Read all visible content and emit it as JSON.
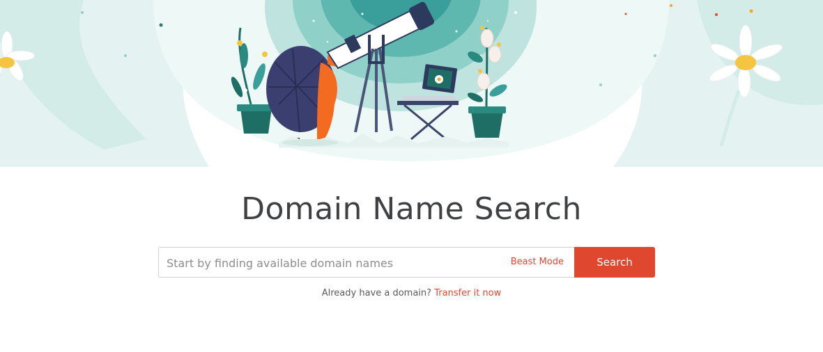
{
  "page": {
    "title": "Domain Name Search"
  },
  "search": {
    "placeholder": "Start by finding available domain names",
    "beast_mode_label": "Beast Mode",
    "button_label": "Search"
  },
  "transfer": {
    "prompt": "Already have a domain?",
    "link_label": "Transfer it now"
  },
  "colors": {
    "accent": "#e0472f",
    "teal": "#3a9e9a",
    "navy": "#2c3a5e",
    "orange": "#f26b21"
  },
  "illustration": {
    "icons": [
      "hedgehog-icon",
      "telescope-icon",
      "laptop-icon",
      "flower-pot-icon",
      "daisy-icon"
    ]
  }
}
